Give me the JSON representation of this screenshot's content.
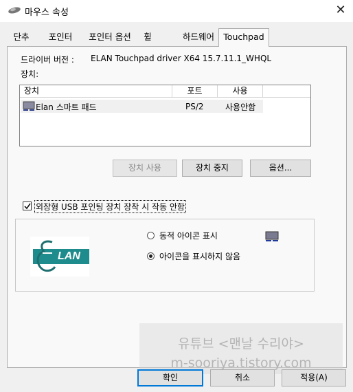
{
  "window": {
    "title": "마우스 속성",
    "close_glyph": "✕"
  },
  "tabs": [
    "단추",
    "포인터",
    "포인터 옵션",
    "휠",
    "하드웨어",
    "Touchpad"
  ],
  "driver": {
    "label": "드라이버 버전 :",
    "value": "ELAN Touchpad driver X64 15.7.11.1_WHQL"
  },
  "devices_label": "장치:",
  "device_table": {
    "columns": [
      "장치",
      "포트",
      "사용"
    ],
    "rows": [
      {
        "name": "Elan 스마트 패드",
        "port": "PS/2",
        "status": "사용안함"
      }
    ]
  },
  "buttons": {
    "enable": "장치 사용",
    "disable": "장치 중지",
    "options": "옵션..."
  },
  "checkbox": {
    "label": "외장형 USB 포인팅 장치 장착 시 작동 안함",
    "checked": true
  },
  "logo_text": "LAN",
  "radios": [
    {
      "label": "동적 아이콘 표시",
      "selected": false
    },
    {
      "label": "아이콘을 표시하지 않음",
      "selected": true
    }
  ],
  "watermark": {
    "line1": "유튜브 <맨날 수리야>",
    "line2": "m-sooriya.tistory.com"
  },
  "footer": {
    "ok": "확인",
    "cancel": "취소",
    "apply": "적용(A)"
  },
  "colors": {
    "accent": "#0078d7",
    "elan_teal": "#1e8c8c"
  }
}
